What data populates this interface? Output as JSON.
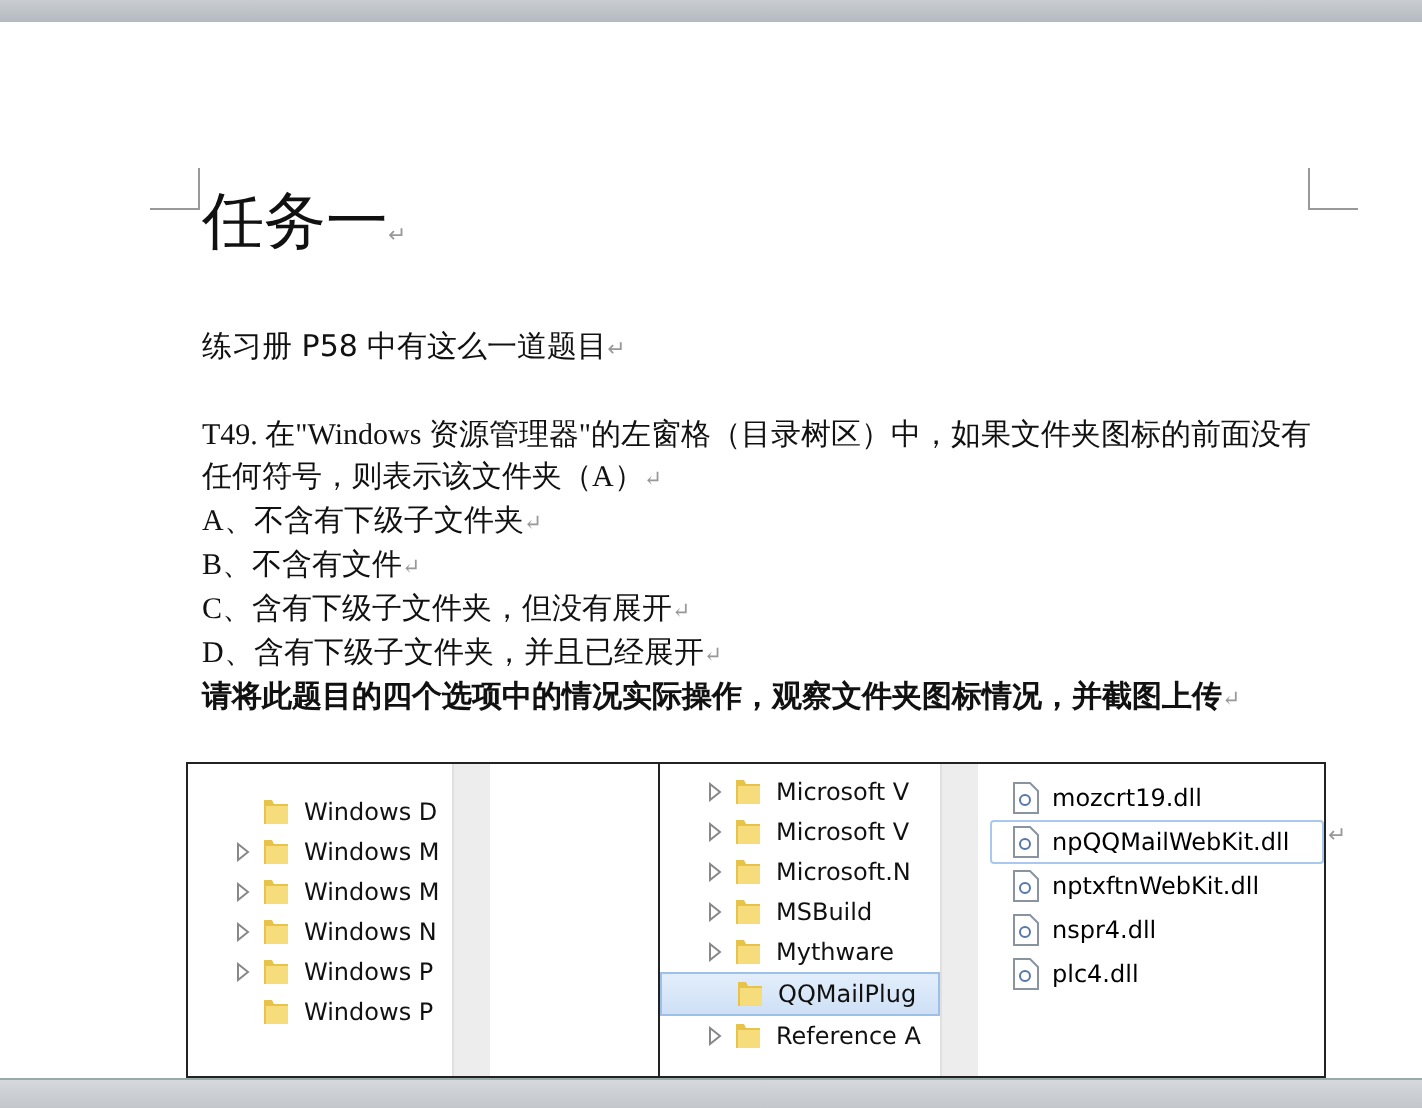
{
  "document": {
    "title": "任务一",
    "paragraph_mark": "↵",
    "intro": "练习册 P58 中有这么一道题目",
    "question": "T49. 在\"Windows 资源管理器\"的左窗格（目录树区）中，如果文件夹图标的前面没有任何符号，则表示该文件夹（A）",
    "options": [
      "A、不含有下级子文件夹",
      "B、不含有文件",
      "C、含有下级子文件夹，但没有展开",
      "D、含有下级子文件夹，并且已经展开"
    ],
    "instruction": "请将此题目的四个选项中的情况实际操作，观察文件夹图标情况，并截图上传"
  },
  "screenshot": {
    "left_tree": [
      {
        "label": "Windows D",
        "expandable": false,
        "selected": false
      },
      {
        "label": "Windows M",
        "expandable": true,
        "selected": false
      },
      {
        "label": "Windows M",
        "expandable": true,
        "selected": false
      },
      {
        "label": "Windows N",
        "expandable": true,
        "selected": false
      },
      {
        "label": "Windows P",
        "expandable": true,
        "selected": false
      },
      {
        "label": "Windows P",
        "expandable": false,
        "selected": false
      }
    ],
    "middle_tree": [
      {
        "label": "Microsoft V",
        "expandable": true,
        "selected": false
      },
      {
        "label": "Microsoft V",
        "expandable": true,
        "selected": false
      },
      {
        "label": "Microsoft.N",
        "expandable": true,
        "selected": false
      },
      {
        "label": "MSBuild",
        "expandable": true,
        "selected": false
      },
      {
        "label": "Mythware",
        "expandable": true,
        "selected": false
      },
      {
        "label": "QQMailPlug",
        "expandable": false,
        "selected": true
      },
      {
        "label": "Reference A",
        "expandable": true,
        "selected": false
      }
    ],
    "files": [
      {
        "name": "mozcrt19.dll",
        "selected": false
      },
      {
        "name": "npQQMailWebKit.dll",
        "selected": true
      },
      {
        "name": "nptxftnWebKit.dll",
        "selected": false
      },
      {
        "name": "nspr4.dll",
        "selected": false
      },
      {
        "name": "plc4.dll",
        "selected": false
      }
    ]
  }
}
